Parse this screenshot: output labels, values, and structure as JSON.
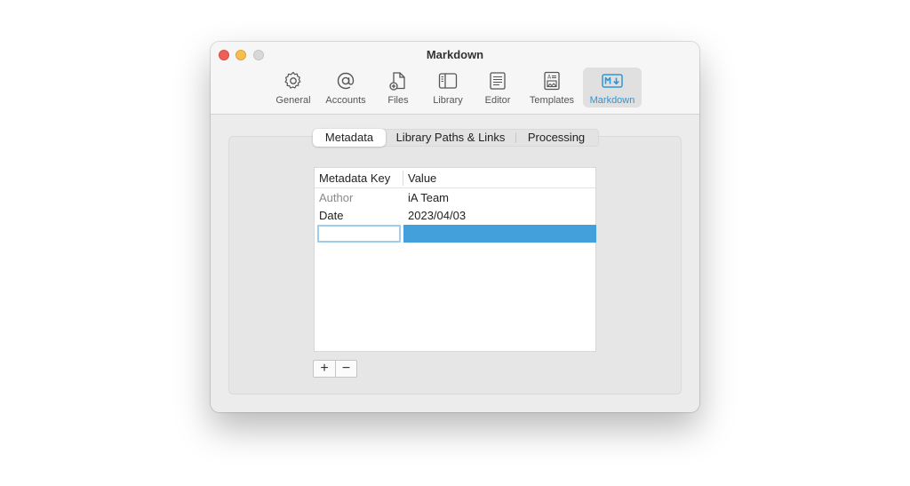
{
  "window": {
    "title": "Markdown"
  },
  "toolbar": {
    "items": [
      {
        "label": "General",
        "icon": "gear-icon"
      },
      {
        "label": "Accounts",
        "icon": "at-icon"
      },
      {
        "label": "Files",
        "icon": "file-add-icon"
      },
      {
        "label": "Library",
        "icon": "sidebar-icon"
      },
      {
        "label": "Editor",
        "icon": "document-lines-icon"
      },
      {
        "label": "Templates",
        "icon": "template-icon"
      },
      {
        "label": "Markdown",
        "icon": "markdown-icon",
        "active": true
      }
    ]
  },
  "tabs": [
    {
      "label": "Metadata",
      "selected": true
    },
    {
      "label": "Library Paths & Links"
    },
    {
      "label": "Processing"
    }
  ],
  "table": {
    "columns": [
      "Metadata Key",
      "Value"
    ],
    "rows": [
      {
        "key": "Author",
        "value": "iA Team"
      },
      {
        "key": "Date",
        "value": "2023/04/03"
      },
      {
        "key": "",
        "value": ""
      }
    ]
  },
  "buttons": {
    "add": "+",
    "remove": "−"
  },
  "colors": {
    "accent": "#2f95d9",
    "selection": "#44a0da"
  }
}
